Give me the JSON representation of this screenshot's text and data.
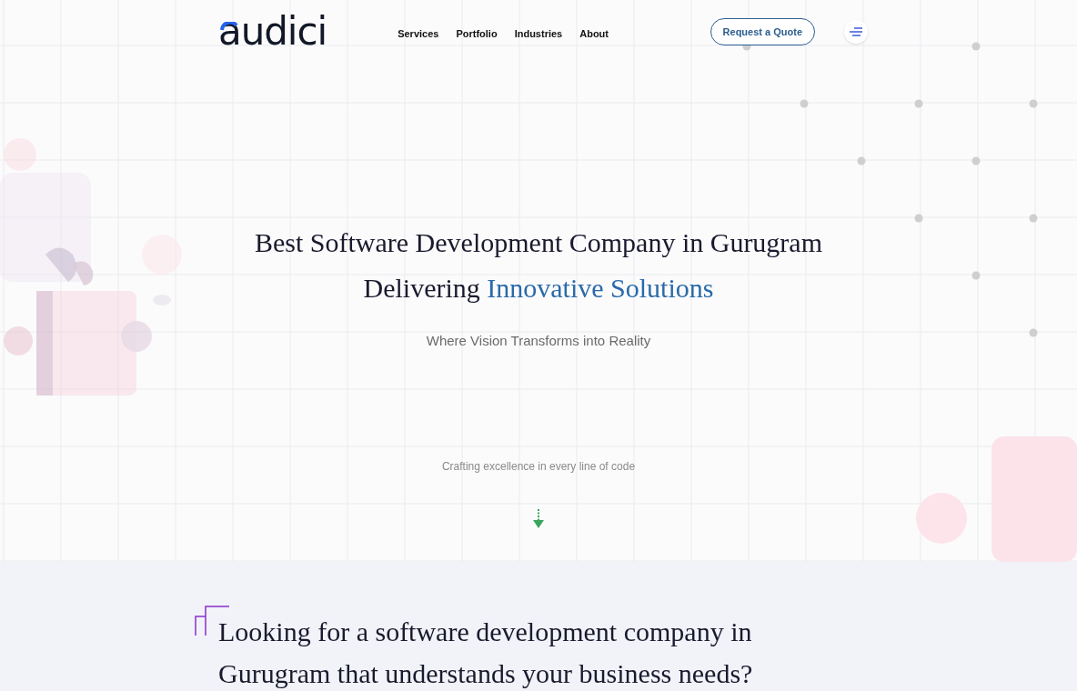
{
  "header": {
    "logo": "audici",
    "nav": [
      {
        "label": "Services"
      },
      {
        "label": "Portfolio"
      },
      {
        "label": "Industries"
      },
      {
        "label": "About"
      }
    ],
    "cta": "Request a Quote"
  },
  "hero": {
    "title_line_1": "Best Software Development Company in Gurugram",
    "title_line_2": {
      "text": "Delivering",
      "highlight": "Innovative Solutions"
    },
    "subtitle": "Where Vision Transforms into Reality",
    "tagline": "Crafting excellence in every line of code"
  },
  "intro": {
    "heading": "Looking for a software development company in Gurugram that understands your business needs?"
  }
}
